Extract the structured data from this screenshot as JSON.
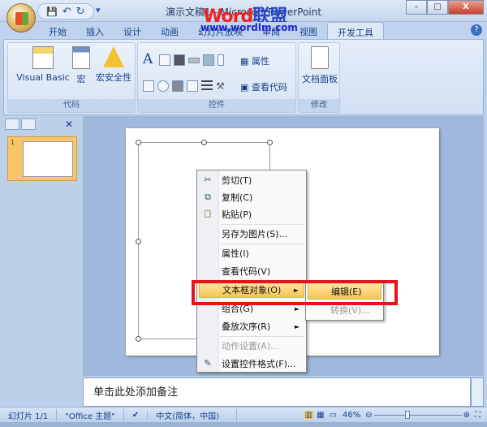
{
  "window": {
    "title": "演示文稿1 - Microsoft PowerPoint",
    "watermark_word": "Word",
    "watermark_cn": "联盟",
    "watermark_url": "www.wordlm.com",
    "minimize": "–",
    "restore": "□",
    "close": "X"
  },
  "qat": {
    "save": "💾",
    "undo": "↶",
    "redo": "↻",
    "more": "▾"
  },
  "tabs": [
    "开始",
    "插入",
    "设计",
    "动画",
    "幻灯片放映",
    "审阅",
    "视图",
    "开发工具"
  ],
  "ribbon": {
    "code": {
      "label": "代码",
      "visual_basic": "Visual Basic",
      "macro": "宏",
      "macro_security": "宏安全性"
    },
    "controls": {
      "label": "控件",
      "properties": "属性",
      "view_code": "查看代码"
    },
    "modify": {
      "label": "修改",
      "doc_panel": "文档面板"
    }
  },
  "slides_pane": {
    "slide_number": "1"
  },
  "context_menu": [
    {
      "label": "剪切(T)",
      "icon": "scissors-icon",
      "glyph": "✂"
    },
    {
      "label": "复制(C)",
      "icon": "copy-icon",
      "glyph": "⧉"
    },
    {
      "label": "粘贴(P)",
      "icon": "paste-icon",
      "glyph": "📋"
    },
    {
      "label": "另存为图片(S)..."
    },
    {
      "label": "属性(I)"
    },
    {
      "label": "查看代码(V)"
    },
    {
      "label": "文本框对象(O)",
      "arrow": "►"
    },
    {
      "label": "组合(G)",
      "arrow": "►"
    },
    {
      "label": "叠放次序(R)",
      "arrow": "►"
    },
    {
      "label": "动作设置(A)..."
    },
    {
      "label": "设置控件格式(F)...",
      "icon": "format-icon",
      "glyph": "✎"
    }
  ],
  "submenu": [
    {
      "label": "编辑(E)"
    },
    {
      "label": "转换(V)..."
    }
  ],
  "notes": {
    "placeholder": "单击此处添加备注"
  },
  "status": {
    "slide": "幻灯片 1/1",
    "theme": "\"Office 主题\"",
    "language": "中文(简体，中国)",
    "zoom": "46%",
    "zoom_percent": 46
  }
}
